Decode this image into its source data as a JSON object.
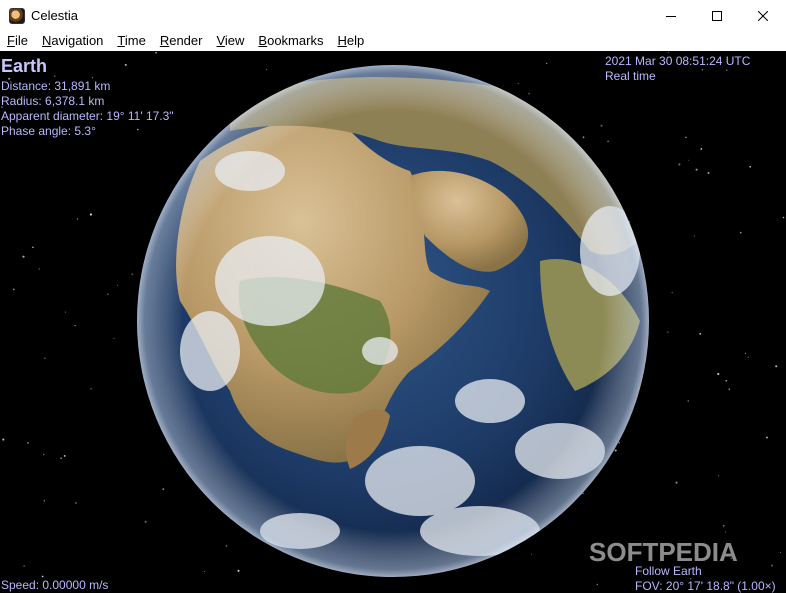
{
  "window": {
    "title": "Celestia"
  },
  "menu": [
    {
      "label": "File",
      "accel": "F",
      "rest": "ile"
    },
    {
      "label": "Navigation",
      "accel": "N",
      "rest": "avigation"
    },
    {
      "label": "Time",
      "accel": "T",
      "rest": "ime"
    },
    {
      "label": "Render",
      "accel": "R",
      "rest": "ender"
    },
    {
      "label": "View",
      "accel": "V",
      "rest": "iew"
    },
    {
      "label": "Bookmarks",
      "accel": "B",
      "rest": "ookmarks"
    },
    {
      "label": "Help",
      "accel": "H",
      "rest": "elp"
    }
  ],
  "hud": {
    "target": "Earth",
    "distance": "Distance: 31,891 km",
    "radius": "Radius: 6,378.1 km",
    "apparent_diameter": "Apparent diameter: 19° 11' 17.3\"",
    "phase_angle": "Phase angle: 5.3°",
    "datetime": "2021 Mar 30 08:51:24 UTC",
    "time_mode": "Real time",
    "speed": "Speed: 0.00000 m/s",
    "follow": "Follow Earth",
    "fov": "FOV: 20° 17' 18.8\" (1.00×)"
  },
  "watermark": "SOFTPEDIA",
  "colors": {
    "hud_text": "#b8b8ff",
    "space": "#000000",
    "ocean": "#1d3a66",
    "land": "#b89866"
  },
  "icons": {
    "app": "celestia-app-icon",
    "minimize": "minimize-icon",
    "maximize": "maximize-icon",
    "close": "close-icon"
  }
}
